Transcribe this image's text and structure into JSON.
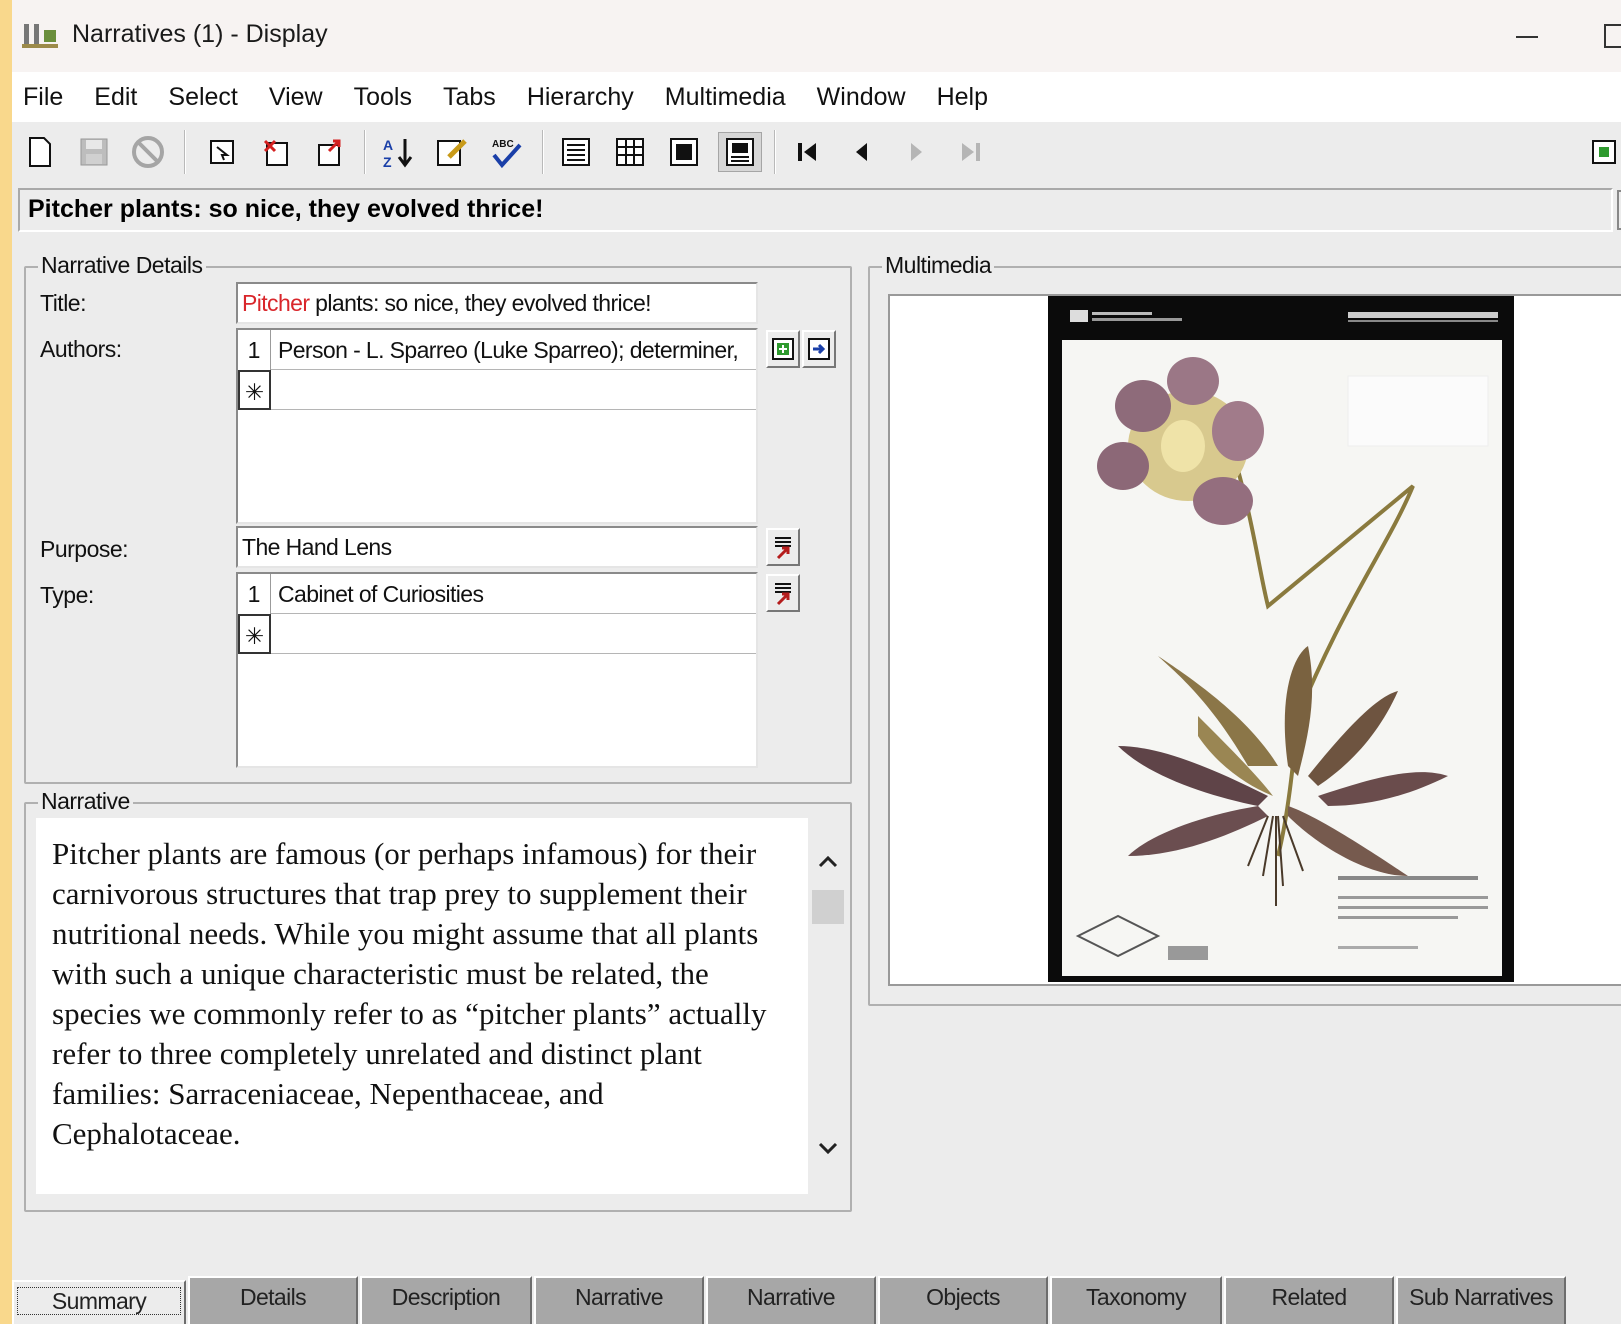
{
  "window": {
    "title": "Narratives (1) - Display"
  },
  "menu": [
    "File",
    "Edit",
    "Select",
    "View",
    "Tools",
    "Tabs",
    "Hierarchy",
    "Multimedia",
    "Window",
    "Help"
  ],
  "heading": "Pitcher plants: so nice, they evolved thrice!",
  "narrative_details": {
    "legend": "Narrative Details",
    "title_label": "Title:",
    "title_highlight": "Pitcher",
    "title_rest": " plants: so nice, they evolved thrice!",
    "authors_label": "Authors:",
    "authors": [
      {
        "row": "1",
        "value": "Person - L. Sparreo (Luke Sparreo); determiner,"
      }
    ],
    "new_row_marker": "✳",
    "purpose_label": "Purpose:",
    "purpose_value": "The Hand Lens",
    "type_label": "Type:",
    "types": [
      {
        "row": "1",
        "value": "Cabinet of Curiosities"
      }
    ]
  },
  "narrative": {
    "legend": "Narrative",
    "text": "Pitcher plants are famous (or perhaps infamous) for their carnivorous structures that trap prey to supplement their nutritional needs. While you might assume that all plants with such a unique characteristic must be related, the species we commonly refer to as “pitcher plants” actually refer to three completely unrelated and distinct plant families: Sarraceniaceae, Nepenthaceae, and Cephalotaceae."
  },
  "multimedia": {
    "legend": "Multimedia"
  },
  "tabs": [
    "Summary",
    "Details",
    "Description",
    "Narrative",
    "Narrative",
    "Objects",
    "Taxonomy",
    "Related",
    "Sub Narratives"
  ],
  "active_tab": "Summary",
  "colors": {
    "highlight": "#d9262b",
    "background": "#ececec",
    "desktop": "#f9d88c"
  }
}
